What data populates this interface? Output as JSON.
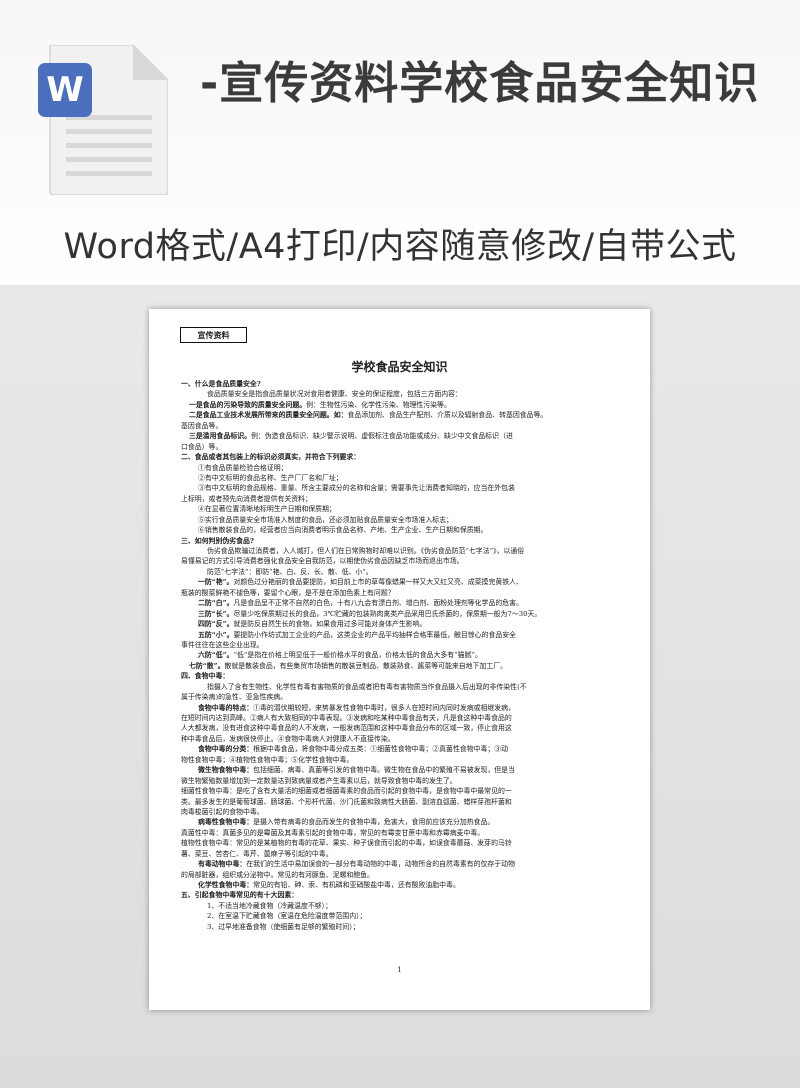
{
  "header": {
    "title": "-宣传资料学校食品安全知识",
    "subtitle": "Word格式/A4打印/内容随意修改/自带公式",
    "icon_letter": "W",
    "icon_color": "#4a6fbf"
  },
  "doc": {
    "tag": "宣传资料",
    "title": "学校食品安全知识",
    "page_number": "1",
    "lines": [
      {
        "cls": "sec",
        "lead": "",
        "text": "一、什么是食品质量安全?"
      },
      {
        "cls": "ind3",
        "lead": "",
        "text": "食品质量安全是指食品质量状况对食用者健康、安全的保证程度，包括三方面内容："
      },
      {
        "cls": "ind1",
        "lead": "一是食品的污染导致的质量安全问题。",
        "text": "例：生物性污染、化学性污染、物理性污染等。"
      },
      {
        "cls": "ind1",
        "lead": "二是食品工业技术发展所带来的质量安全问题。如：",
        "text": "食品添加剂、食品生产配剂、介质以及辐射食品、转基因食品等。"
      },
      {
        "cls": "",
        "lead": "",
        "text": "基因食品等。"
      },
      {
        "cls": "ind1",
        "lead": "三是滥用食品标识。",
        "text": "例：伪造食品标识、缺少警示说明、虚假标注食品功能或成分、缺少中文食品标识（进"
      },
      {
        "cls": "",
        "lead": "",
        "text": "口食品）等。"
      },
      {
        "cls": "sec",
        "lead": "",
        "text": "二、食品或者其包装上的标识必须真实，并符合下列要求："
      },
      {
        "cls": "ind2",
        "lead": "",
        "text": "①有食品质量检验合格证明；"
      },
      {
        "cls": "ind2",
        "lead": "",
        "text": "②有中文标明的食品名称、生产厂厂名和厂址；"
      },
      {
        "cls": "ind2",
        "lead": "",
        "text": "③有中文标明的食品规格、重量、所含主要成分的名称和含量；需要事先让消费者知晓的，应当在外包装"
      },
      {
        "cls": "",
        "lead": "",
        "text": "上标明，或者预先向消费者提供有关资料；"
      },
      {
        "cls": "ind2",
        "lead": "",
        "text": "④在显著位置清晰地标明生产日期和保质期；"
      },
      {
        "cls": "ind2",
        "lead": "",
        "text": "⑤实行食品质量安全市场准入制度的食品，还必须加贴食品质量安全市场准入标志；"
      },
      {
        "cls": "ind2",
        "lead": "",
        "text": "⑥销售散装食品的，经营者应当向消费者明示食品名称、产地、生产企业、生产日期和保质期。"
      },
      {
        "cls": "sec",
        "lead": "",
        "text": "三、如何判别伪劣食品?"
      },
      {
        "cls": "ind3",
        "lead": "",
        "text": "伪劣食品欺骗过消费者，入人城打，但人们在日常购物时却难以识别。《伪劣食品防范“七字法”》，以通俗"
      },
      {
        "cls": "",
        "lead": "",
        "text": "易懂易记的方式引导消费者强化食品安全自我防范，以期使伪劣食品因缺乏市场而退出市场。"
      },
      {
        "cls": "ind3",
        "lead": "",
        "text": "防范“七字法”：即防“艳、白、反、长、散、低、小”。"
      },
      {
        "cls": "ind2",
        "lead": "一防“艳”。",
        "text": "对颜色过分艳丽的食品要提防，如目前上市的草莓像蜡果一样又大又红又亮、成菜摸完黄铁人、"
      },
      {
        "cls": "",
        "lead": "",
        "text": "瓶装的酸菜鲜艳不褪色等，要留个心眼，是不是在添加色素上有问题？"
      },
      {
        "cls": "ind2",
        "lead": "二防“白”。",
        "text": "凡是食品呈不正常不自然的白色，十有八九会有漂白剂、增白剂、面粉处理剂等化学品的危害。"
      },
      {
        "cls": "ind2",
        "lead": "三防“长”。",
        "text": "尽量少吃保质期过长的食品，3℃贮藏的包装熟肉禽类产品采用巴氏杀菌的，保质期一般为7～30天。"
      },
      {
        "cls": "ind2",
        "lead": "四防“反”。",
        "text": "就是防反自然生长的食物，如果食用过多可能对身体产生影响。"
      },
      {
        "cls": "ind2",
        "lead": "五防“小”。",
        "text": "要提防小作坊式加工企业的产品，这类企业的产品平均抽样合格率最低，触目惊心的食品安全"
      },
      {
        "cls": "",
        "lead": "",
        "text": "事件往往在这些企业出现。"
      },
      {
        "cls": "ind2",
        "lead": "六防“低”。",
        "text": "“低”是指在价格上明显低于一般价格水平的食品，价格太低的食品大多有“猫腻”。"
      },
      {
        "cls": "ind1",
        "lead": "七防“散”。",
        "text": "散就是散装食品，有些集贸市场销售的散装豆制品、散装熟食、酱菜等可能来自地下加工厂。"
      },
      {
        "cls": "sec",
        "lead": "",
        "text": "四、食物中毒："
      },
      {
        "cls": "ind3",
        "lead": "",
        "text": "指摄入了含有生物性、化学性有毒有害物质的食品或者把有毒有害物质当作食品摄入后出现的非传染性(不"
      },
      {
        "cls": "",
        "lead": "",
        "text": "属于传染病)的急性、亚急性疾病。"
      },
      {
        "cls": "ind2",
        "lead": "食物中毒的特点：",
        "text": "①毒的潜伏期较短，来势暴发性食物中毒时，很多人在短时间内同时发病或相继发病，"
      },
      {
        "cls": "",
        "lead": "",
        "text": "在短时间内达到高峰。②病人有大致相同的中毒表现。③发病和吃某种中毒食品有关，凡是食这种中毒食品的"
      },
      {
        "cls": "",
        "lead": "",
        "text": "人大都发病，没有进食这种中毒食品的人不发病，一般发病范围和这种中毒食品分布的区域一致，停止食用这"
      },
      {
        "cls": "",
        "lead": "",
        "text": "种中毒食品后，发病很快停止。④食物中毒病人对健康人不直接传染。"
      },
      {
        "cls": "ind2",
        "lead": "食物中毒的分类：",
        "text": "根据中毒食品，将食物中毒分成五类：①细菌性食物中毒；②真菌性食物中毒；③动"
      },
      {
        "cls": "",
        "lead": "",
        "text": "物性食物中毒；④植物性食物中毒；⑤化学性食物中毒。"
      },
      {
        "cls": "ind2",
        "lead": "微生物食物中毒：",
        "text": "包括细菌、病毒、真菌等引发的食物中毒。微生物在食品中的繁殖不易被发现，但是当"
      },
      {
        "cls": "",
        "lead": "",
        "text": "微生物繁殖数量增加到一定数量达到致病量或者产生毒素以后，就导致食物中毒的发生了。"
      },
      {
        "cls": "",
        "lead": "",
        "text": "细菌性食物中毒：是吃了含有大量活的细菌或者细菌毒素的食品而引起的食物中毒，是食物中毒中最常见的一"
      },
      {
        "cls": "",
        "lead": "",
        "text": "类。最多发生的是葡萄球菌、肠球菌、个形杆代菌、沙门氏菌和致病性大肠菌、副溶血弧菌、蜡样芽孢杆菌和"
      },
      {
        "cls": "",
        "lead": "",
        "text": "肉毒梭菌引起的食物中毒。"
      },
      {
        "cls": "ind2",
        "lead": "病毒性食物中毒：",
        "text": "是摄入带有病毒的食品而发生的食物中毒，危害大，食用前应该充分加热食品。"
      },
      {
        "cls": "",
        "lead": "",
        "text": "真菌性中毒：真菌多见的是霉菌及其毒素引起的食物中毒，常见的有霉变甘蔗中毒和赤霉病麦中毒。"
      },
      {
        "cls": "",
        "lead": "",
        "text": "植物性食物中毒：常见的是某植物的有毒的花草、果实、种子误食而引起的中毒，如误食毒蘑菇、发芽的马铃"
      },
      {
        "cls": "",
        "lead": "",
        "text": "薯、菜豆、苦杏仁、毒芹、蓖麻子等引起的中毒。"
      },
      {
        "cls": "ind2",
        "lead": "有毒动物中毒：",
        "text": "在我们的生活中易加误食的一部分有毒动物的中毒，动物所含的自然毒素有的仅存于动物"
      },
      {
        "cls": "",
        "lead": "",
        "text": "的局部脏器，组织或分泌物中。常见的有河豚鱼、泥螺和鲍鱼。"
      },
      {
        "cls": "ind2",
        "lead": "化学性食物中毒：",
        "text": "常见的有铅、砷、汞、有机磷和亚硝酸盐中毒，还有酸败油脂中毒。"
      },
      {
        "cls": "sec",
        "lead": "",
        "text": "五、引起食物中毒常见的有十大因素："
      },
      {
        "cls": "ind3",
        "lead": "",
        "text": "1、不适当地冷藏食物（冷藏温度不够）；"
      },
      {
        "cls": "ind3",
        "lead": "",
        "text": "2、在室温下贮藏食物（室温在危险温度带范围内）；"
      },
      {
        "cls": "ind3",
        "lead": "",
        "text": "3、过早地准备食物（使细菌有足够的繁殖时间）；"
      }
    ]
  }
}
